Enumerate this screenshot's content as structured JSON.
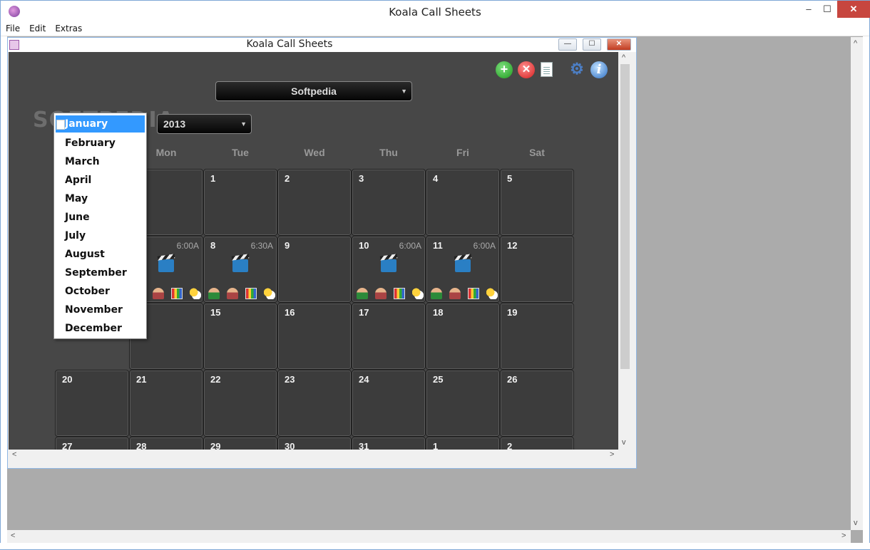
{
  "window": {
    "title": "Koala Call Sheets",
    "controls": {
      "minimize": "–",
      "maximize": "☐",
      "close": "✕"
    }
  },
  "menu": [
    "File",
    "Edit",
    "Extras"
  ],
  "inner_window": {
    "title": "Koala Call Sheets",
    "controls": {
      "minimize": "—",
      "maximize": "☐",
      "close": "✕"
    }
  },
  "toolbar": {
    "add": "+",
    "remove": "✕",
    "gear": "⚙",
    "info": "i"
  },
  "project_select": {
    "value": "Softpedia",
    "arrow": "▼"
  },
  "year_select": {
    "value": "2013",
    "arrow": "▼"
  },
  "watermark": "SOFTPEDIA",
  "weekdays": [
    "Mon",
    "Tue",
    "Wed",
    "Thu",
    "Fri",
    "Sat"
  ],
  "months": [
    "January",
    "February",
    "March",
    "April",
    "May",
    "June",
    "July",
    "August",
    "September",
    "October",
    "November",
    "December"
  ],
  "selected_month": "January",
  "calendar": {
    "row1": [
      {
        "d": ""
      },
      {
        "d": "1"
      },
      {
        "d": "2"
      },
      {
        "d": "3"
      },
      {
        "d": "4"
      },
      {
        "d": "5"
      }
    ],
    "row2": [
      {
        "d": "",
        "time": "6:00A",
        "shoot": true
      },
      {
        "d": "8",
        "time": "6:30A",
        "shoot": true
      },
      {
        "d": "9"
      },
      {
        "d": "10",
        "time": "6:00A",
        "shoot": true
      },
      {
        "d": "11",
        "time": "6:00A",
        "shoot": true
      },
      {
        "d": "12"
      }
    ],
    "row3": [
      {
        "d": ""
      },
      {
        "d": "15"
      },
      {
        "d": "16"
      },
      {
        "d": "17"
      },
      {
        "d": "18"
      },
      {
        "d": "19"
      }
    ],
    "row4": [
      {
        "d": "20"
      },
      {
        "d": "21"
      },
      {
        "d": "22"
      },
      {
        "d": "23"
      },
      {
        "d": "24"
      },
      {
        "d": "25"
      },
      {
        "d": "26"
      }
    ],
    "row5": [
      {
        "d": "27"
      },
      {
        "d": "28"
      },
      {
        "d": "29"
      },
      {
        "d": "30"
      },
      {
        "d": "31"
      },
      {
        "d": "1"
      },
      {
        "d": "2"
      }
    ]
  },
  "scroll": {
    "up": "▲",
    "down": "▼",
    "left": "◀",
    "right": "▶",
    "up2": "^",
    "down2": "v",
    "left2": "<",
    "right2": ">"
  }
}
